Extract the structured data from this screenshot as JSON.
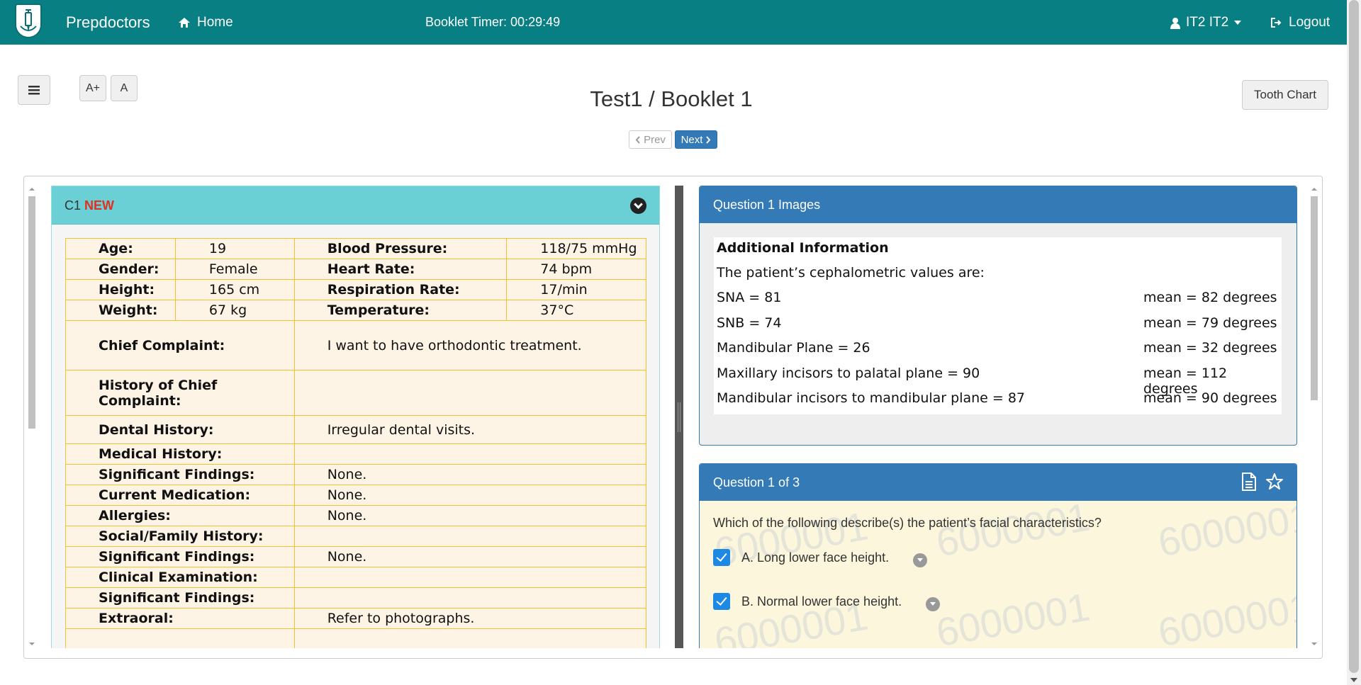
{
  "navbar": {
    "brand": "Prepdoctors",
    "home": "Home",
    "timer": "Booklet Timer: 00:29:49",
    "user": "IT2 IT2",
    "logout": "Logout"
  },
  "toolbar": {
    "font_increase": "A+",
    "font_normal": "A",
    "tooth_chart": "Tooth Chart"
  },
  "page": {
    "title": "Test1 / Booklet 1",
    "prev": "Prev",
    "next": "Next"
  },
  "case": {
    "label": "C1",
    "badge": "NEW",
    "vitals": [
      {
        "l1": "Age:",
        "v1": "19",
        "l2": "Blood Pressure:",
        "v2": "118/75 mmHg"
      },
      {
        "l1": "Gender:",
        "v1": "Female",
        "l2": "Heart Rate:",
        "v2": "74 bpm"
      },
      {
        "l1": "Height:",
        "v1": "165 cm",
        "l2": "Respiration Rate:",
        "v2": "17/min"
      },
      {
        "l1": "Weight:",
        "v1": "67 kg",
        "l2": "Temperature:",
        "v2": "37°C"
      }
    ],
    "history": [
      {
        "label": "Chief Complaint:",
        "value": "I want to have orthodontic treatment."
      },
      {
        "label": "History of Chief Complaint:",
        "value": ""
      },
      {
        "label": "Dental History:",
        "value": "Irregular dental visits."
      },
      {
        "label": "Medical History:",
        "value": ""
      },
      {
        "label": "Significant Findings:",
        "value": "None."
      },
      {
        "label": "Current Medication:",
        "value": "None."
      },
      {
        "label": "Allergies:",
        "value": "None."
      },
      {
        "label": "Social/Family History:",
        "value": ""
      },
      {
        "label": "Significant Findings:",
        "value": "None."
      },
      {
        "label": "Clinical Examination:",
        "value": ""
      },
      {
        "label": "Significant Findings:",
        "value": ""
      },
      {
        "label": "Extraoral:",
        "value": "Refer to photographs."
      }
    ]
  },
  "images_panel": {
    "title": "Question 1 Images",
    "heading": "Additional Information",
    "intro": "The patient’s cephalometric values are:",
    "rows": [
      {
        "measure": "SNA = 81",
        "mean": "mean = 82 degrees"
      },
      {
        "measure": "SNB = 74",
        "mean": "mean = 79 degrees"
      },
      {
        "measure": "Mandibular Plane = 26",
        "mean": "mean = 32 degrees"
      },
      {
        "measure": "Maxillary incisors to palatal plane = 90",
        "mean": "mean = 112 degrees"
      },
      {
        "measure": "Mandibular incisors to mandibular plane = 87",
        "mean": "mean = 90 degrees"
      }
    ]
  },
  "question": {
    "title": "Question 1 of 3",
    "text": "Which of the following describe(s) the patient’s facial characteristics?",
    "watermark": "6000001",
    "options": [
      {
        "label": "A. Long lower face height.",
        "checked": true
      },
      {
        "label": "B. Normal lower face height.",
        "checked": true
      }
    ]
  }
}
